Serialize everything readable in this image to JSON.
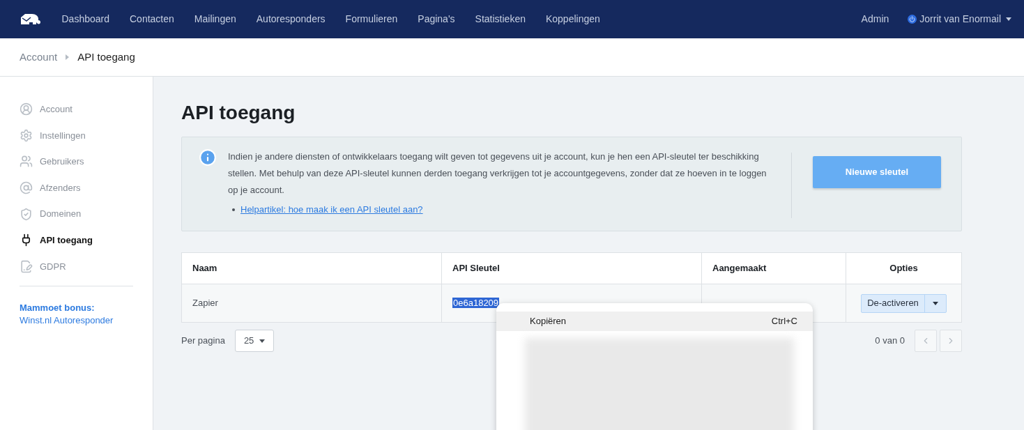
{
  "nav": {
    "items": [
      "Dashboard",
      "Contacten",
      "Mailingen",
      "Autoresponders",
      "Formulieren",
      "Pagina's",
      "Statistieken",
      "Koppelingen"
    ],
    "admin": "Admin",
    "user": "Jorrit van Enormail"
  },
  "breadcrumb": [
    "Account",
    "API toegang"
  ],
  "sidebar": {
    "items": [
      {
        "label": "Account",
        "kind": "user",
        "selected": false
      },
      {
        "label": "Instellingen",
        "kind": "gear",
        "selected": false
      },
      {
        "label": "Gebruikers",
        "kind": "users",
        "selected": false
      },
      {
        "label": "Afzenders",
        "kind": "at",
        "selected": false
      },
      {
        "label": "Domeinen",
        "kind": "shield",
        "selected": false
      },
      {
        "label": "API toegang",
        "kind": "plug",
        "selected": true
      },
      {
        "label": "GDPR",
        "kind": "document",
        "selected": false
      }
    ],
    "bonus_title": "Mammoet bonus:",
    "bonus_link": "Winst.nl Autoresponder"
  },
  "page_title": "API toegang",
  "info": {
    "text": "Indien je andere diensten of ontwikkelaars toegang wilt geven tot gegevens uit je account, kun je hen een API-sleutel ter beschikking stellen. Met behulp van deze API-sleutel kunnen derden toegang verkrijgen tot je accountgegevens, zonder dat ze hoeven in te loggen op je account.",
    "link": "Helpartikel: hoe maak ik een API sleutel aan?",
    "button": "Nieuwe sleutel"
  },
  "table": {
    "columns": [
      "Naam",
      "API Sleutel",
      "Aangemaakt",
      "Opties"
    ],
    "rows": [
      {
        "name": "Zapier",
        "key": "0e6a18209",
        "action": "De-activeren"
      }
    ]
  },
  "per_page": {
    "label": "Per pagina",
    "value": "25"
  },
  "pagination": {
    "text": "0 van 0"
  },
  "context_menu": {
    "items": [
      {
        "label": "Kopiëren",
        "shortcut": "Ctrl+C",
        "selected": true
      }
    ]
  }
}
